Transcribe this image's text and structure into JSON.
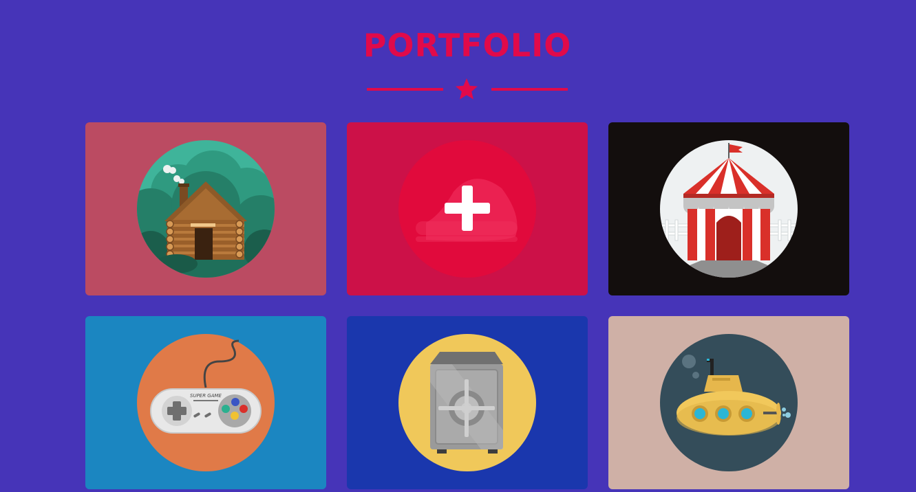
{
  "header": {
    "title": "PORTFOLIO",
    "divider_icon": "star-icon"
  },
  "colors": {
    "background": "#4634b8",
    "accent": "#e10a4a"
  },
  "portfolio": {
    "items": [
      {
        "icon": "log-cabin-icon",
        "background": "#bb4b62"
      },
      {
        "icon": "plus-icon",
        "background": "#cc1148",
        "hovered": true
      },
      {
        "icon": "circus-tent-icon",
        "background": "#130e0d"
      },
      {
        "icon": "game-controller-icon",
        "background": "#1b86c1",
        "controller_brand": "SUPER GAME"
      },
      {
        "icon": "safe-icon",
        "background": "#1a37ad"
      },
      {
        "icon": "submarine-icon",
        "background": "#cfb0a6"
      }
    ]
  }
}
